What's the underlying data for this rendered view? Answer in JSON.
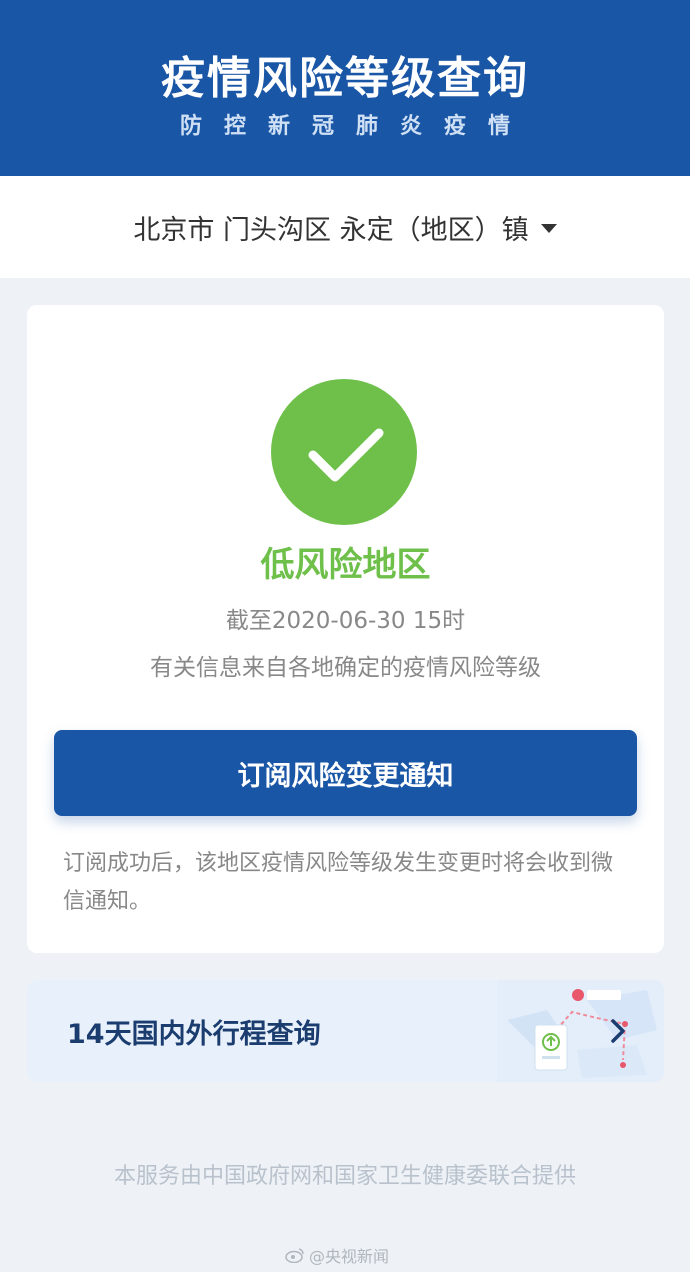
{
  "header": {
    "title": "疫情风险等级查询",
    "subtitle": "防控新冠肺炎疫情"
  },
  "location": {
    "text": "北京市 门头沟区 永定（地区）镇",
    "dropdown_icon": "caret-down-icon"
  },
  "status_card": {
    "status_icon": "check-icon",
    "risk_level": "低风险地区",
    "update_time": "截至2020-06-30 15时",
    "info_source": "有关信息来自各地确定的疫情风险等级",
    "subscribe_button_label": "订阅风险变更通知",
    "subscribe_note": "订阅成功后，该地区疫情风险等级发生变更时将会收到微信通知。"
  },
  "trip_card": {
    "label": "14天国内外行程查询",
    "illustration_icon": "travel-map-icon",
    "arrow_icon": "chevron-right-icon"
  },
  "footer": {
    "text": "本服务由中国政府网和国家卫生健康委联合提供"
  },
  "watermark": {
    "text": "@央视新闻"
  },
  "colors": {
    "brand_blue": "#1a56a6",
    "low_risk_green": "#6ec04a",
    "page_background": "#eef2f6"
  }
}
